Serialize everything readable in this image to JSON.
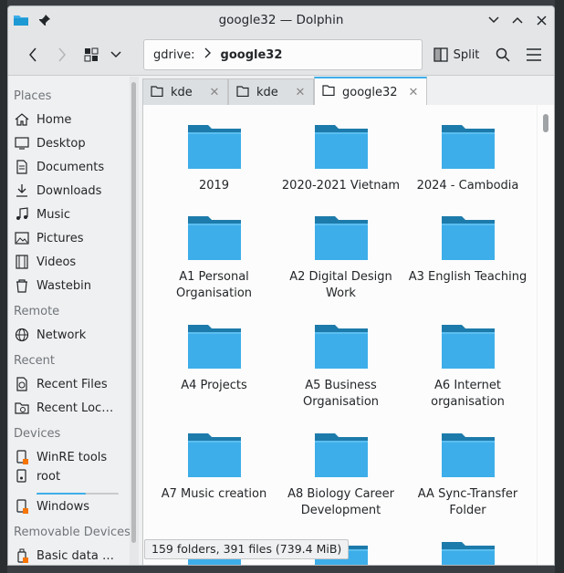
{
  "window": {
    "title": "google32 — Dolphin"
  },
  "toolbar": {
    "split_label": "Split",
    "breadcrumb": {
      "root": "gdrive:",
      "current": "google32"
    }
  },
  "sidebar": {
    "sections": [
      {
        "title": "Places",
        "items": [
          {
            "label": "Home",
            "icon": "home-icon"
          },
          {
            "label": "Desktop",
            "icon": "desktop-icon"
          },
          {
            "label": "Documents",
            "icon": "documents-icon"
          },
          {
            "label": "Downloads",
            "icon": "downloads-icon"
          },
          {
            "label": "Music",
            "icon": "music-icon"
          },
          {
            "label": "Pictures",
            "icon": "pictures-icon"
          },
          {
            "label": "Videos",
            "icon": "videos-icon"
          },
          {
            "label": "Wastebin",
            "icon": "wastebin-icon"
          }
        ]
      },
      {
        "title": "Remote",
        "items": [
          {
            "label": "Network",
            "icon": "network-icon"
          }
        ]
      },
      {
        "title": "Recent",
        "items": [
          {
            "label": "Recent Files",
            "icon": "recent-files-icon"
          },
          {
            "label": "Recent Locat…",
            "icon": "recent-locations-icon"
          }
        ]
      },
      {
        "title": "Devices",
        "items": [
          {
            "label": "WinRE tools",
            "icon": "drive-icon"
          },
          {
            "label": "root",
            "icon": "drive-icon",
            "usage": 0.6
          },
          {
            "label": "Windows",
            "icon": "drive-icon"
          }
        ]
      },
      {
        "title": "Removable Devices",
        "items": [
          {
            "label": "Basic data p…",
            "icon": "usb-drive-icon"
          }
        ]
      }
    ]
  },
  "tabs": [
    {
      "label": "kde",
      "active": false
    },
    {
      "label": "kde",
      "active": false
    },
    {
      "label": "google32",
      "active": true
    }
  ],
  "folders": [
    {
      "name": "2019"
    },
    {
      "name": "2020-2021 Vietnam"
    },
    {
      "name": "2024 - Cambodia"
    },
    {
      "name": "A1 Personal Organisation"
    },
    {
      "name": "A2 Digital Design Work"
    },
    {
      "name": "A3 English Teaching"
    },
    {
      "name": "A4 Projects"
    },
    {
      "name": "A5 Business Organisation"
    },
    {
      "name": "A6 Internet organisation"
    },
    {
      "name": "A7 Music creation"
    },
    {
      "name": "A8 Biology Career Development"
    },
    {
      "name": "AA Sync-Transfer Folder"
    },
    {
      "name": ""
    },
    {
      "name": ""
    },
    {
      "name": ""
    }
  ],
  "status": {
    "text": "159 folders, 391 files (739.4 MiB)"
  },
  "colors": {
    "accent": "#3daee9",
    "folder": "#3daee9",
    "folder_dark": "#1d7bab"
  }
}
